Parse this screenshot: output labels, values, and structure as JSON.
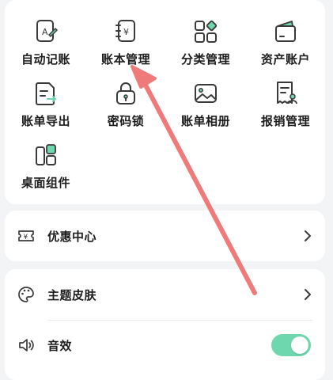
{
  "grid": {
    "items": [
      {
        "label": "自动记账",
        "icon": "auto-bookkeeping-icon"
      },
      {
        "label": "账本管理",
        "icon": "ledger-management-icon"
      },
      {
        "label": "分类管理",
        "icon": "category-management-icon"
      },
      {
        "label": "资产账户",
        "icon": "asset-account-icon"
      },
      {
        "label": "账单导出",
        "icon": "bill-export-icon"
      },
      {
        "label": "密码锁",
        "icon": "password-lock-icon"
      },
      {
        "label": "账单相册",
        "icon": "bill-album-icon"
      },
      {
        "label": "报销管理",
        "icon": "reimbursement-icon"
      },
      {
        "label": "桌面组件",
        "icon": "desktop-widget-icon"
      }
    ]
  },
  "promo": {
    "label": "优惠中心",
    "icon": "coupon-icon"
  },
  "settings": {
    "theme_label": "主题皮肤",
    "theme_icon": "palette-icon",
    "sound_label": "音效",
    "sound_icon": "speaker-icon",
    "sound_enabled": true
  },
  "colors": {
    "accent": "#6fd7ae",
    "icon_stroke": "#3a3a3a",
    "annotation_arrow": "#ee7a7a"
  }
}
